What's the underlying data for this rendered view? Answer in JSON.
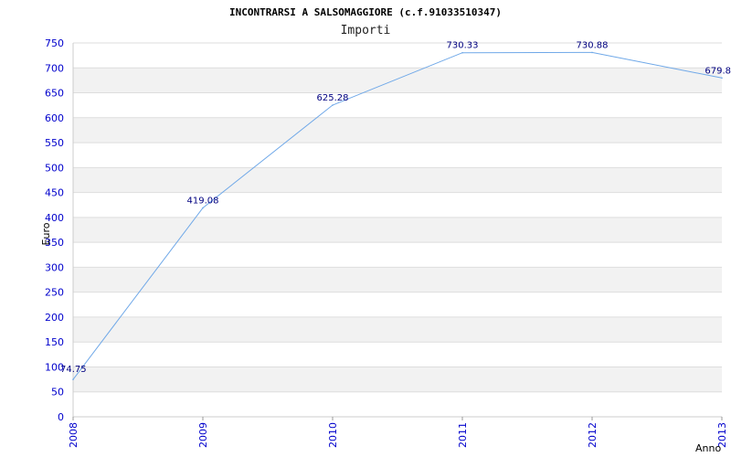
{
  "chart_data": {
    "type": "line",
    "title": "INCONTRARSI A SALSOMAGGIORE (c.f.91033510347)",
    "subtitle": "Importi",
    "xlabel": "Anno",
    "ylabel": "Euro",
    "categories": [
      "2008",
      "2009",
      "2010",
      "2011",
      "2012",
      "2013"
    ],
    "series": [
      {
        "values": [
          74.75,
          419.08,
          625.28,
          730.33,
          730.88,
          679.8
        ]
      }
    ],
    "data_labels": [
      "74.75",
      "419.08",
      "625.28",
      "730.33",
      "730.88",
      "679.8"
    ],
    "yticks": [
      0,
      50,
      100,
      150,
      200,
      250,
      300,
      350,
      400,
      450,
      500,
      550,
      600,
      650,
      700,
      750
    ],
    "ylim": [
      0,
      750
    ],
    "grid": "horizontal alternating bands",
    "colors": {
      "line": "#6fa8e8",
      "ticks": "#0000cc",
      "band": "#f2f2f2",
      "gridline": "#dddddd",
      "data_label": "#000080"
    }
  }
}
